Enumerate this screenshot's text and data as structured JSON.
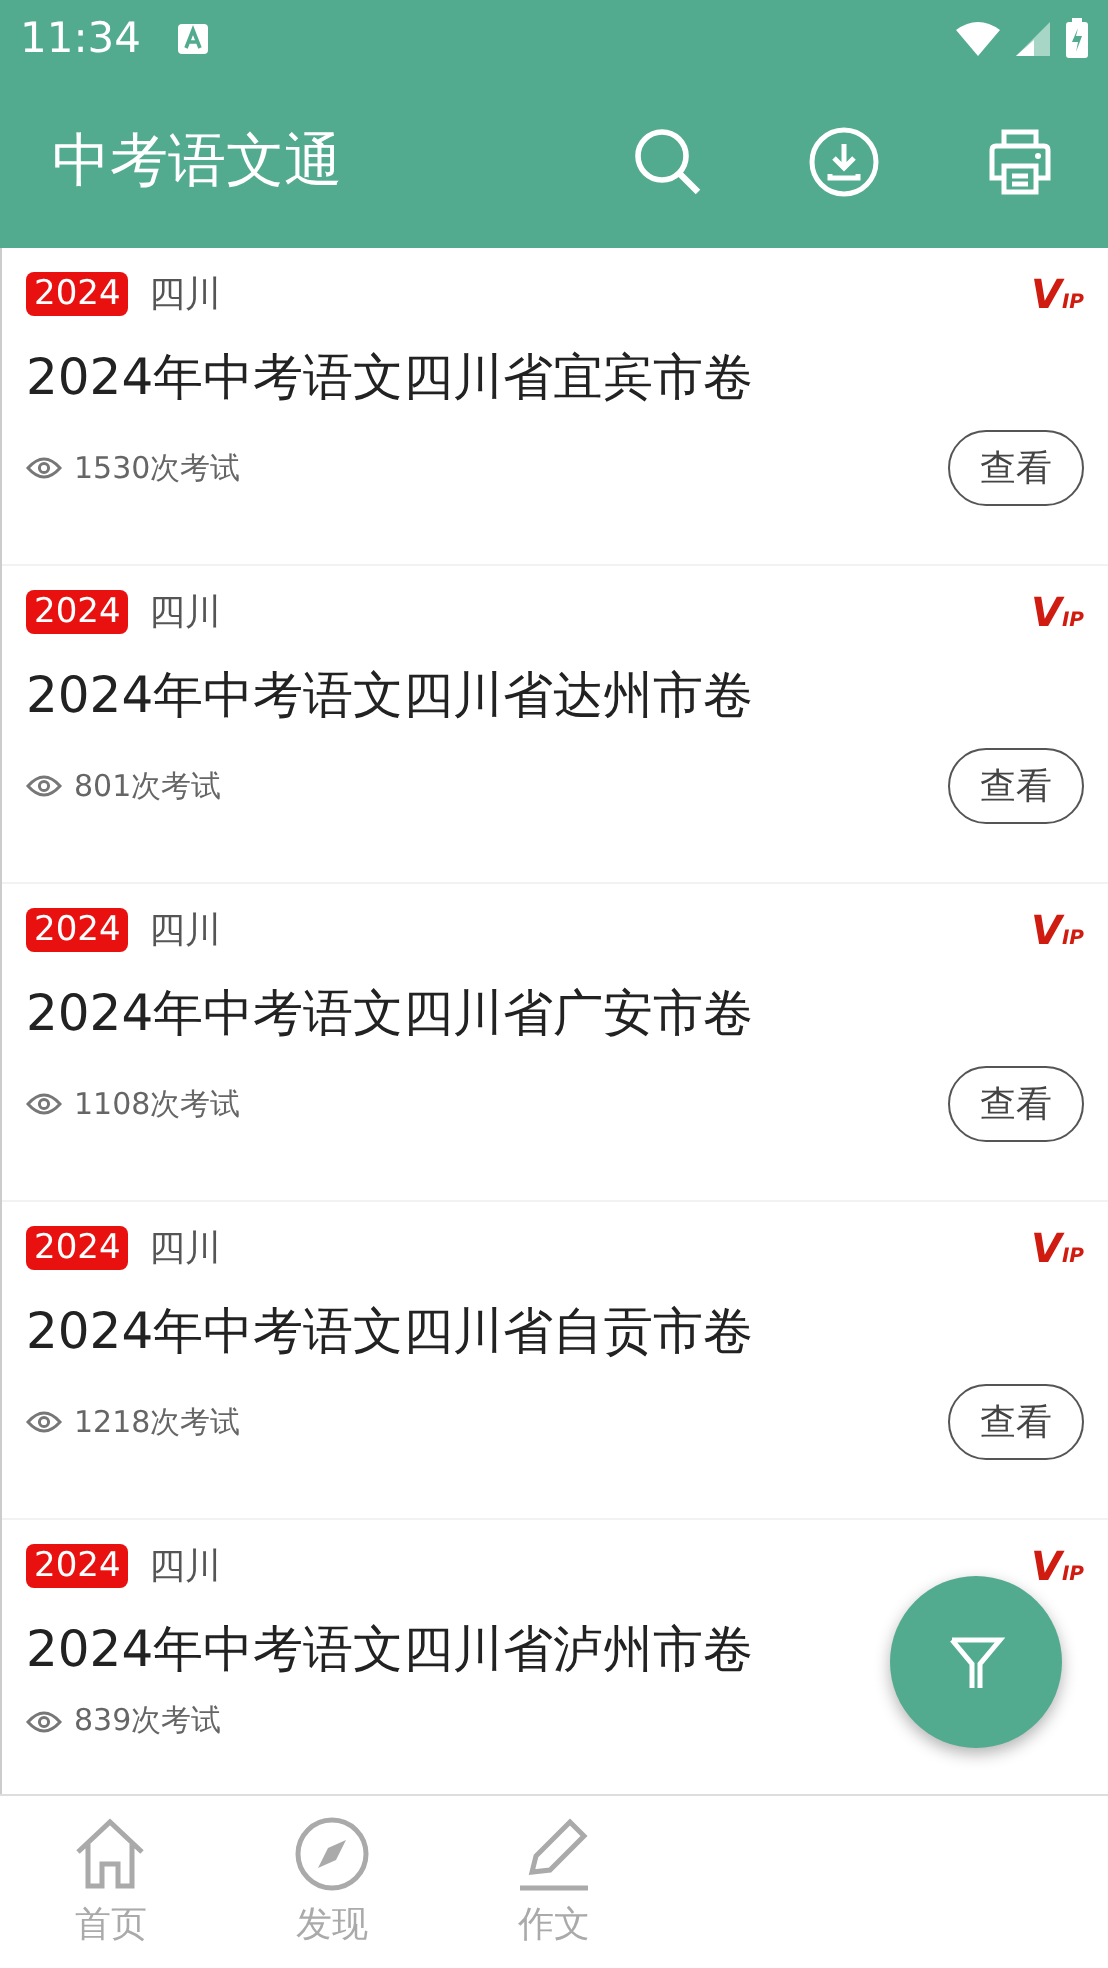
{
  "status_bar": {
    "time": "11:34"
  },
  "app_bar": {
    "title": "中考语文通"
  },
  "papers": [
    {
      "year": "2024",
      "region": "四川",
      "badge": "VIP",
      "title": "2024年中考语文四川省宜宾市卷",
      "count": "1530次考试",
      "button": "查看"
    },
    {
      "year": "2024",
      "region": "四川",
      "badge": "VIP",
      "title": "2024年中考语文四川省达州市卷",
      "count": "801次考试",
      "button": "查看"
    },
    {
      "year": "2024",
      "region": "四川",
      "badge": "VIP",
      "title": "2024年中考语文四川省广安市卷",
      "count": "1108次考试",
      "button": "查看"
    },
    {
      "year": "2024",
      "region": "四川",
      "badge": "VIP",
      "title": "2024年中考语文四川省自贡市卷",
      "count": "1218次考试",
      "button": "查看"
    },
    {
      "year": "2024",
      "region": "四川",
      "badge": "VIP",
      "title": "2024年中考语文四川省泸州市卷",
      "count": "839次考试"
    }
  ],
  "bottom_nav": [
    {
      "kind": "home",
      "label": "首页"
    },
    {
      "kind": "discover",
      "label": "发现"
    },
    {
      "kind": "essay",
      "label": "作文"
    }
  ]
}
